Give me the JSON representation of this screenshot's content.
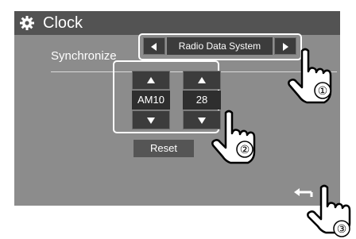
{
  "header": {
    "title": "Clock",
    "icon": "gear-icon"
  },
  "synchronize": {
    "label": "Synchronize",
    "value": "Radio Data System",
    "prev_icon": "triangle-left-icon",
    "next_icon": "triangle-right-icon"
  },
  "time": {
    "hour": "AM10",
    "separator": ":",
    "minute": "28"
  },
  "reset_label": "Reset",
  "back_icon": "return-arrow-icon",
  "callouts": [
    "①",
    "②",
    "③"
  ]
}
